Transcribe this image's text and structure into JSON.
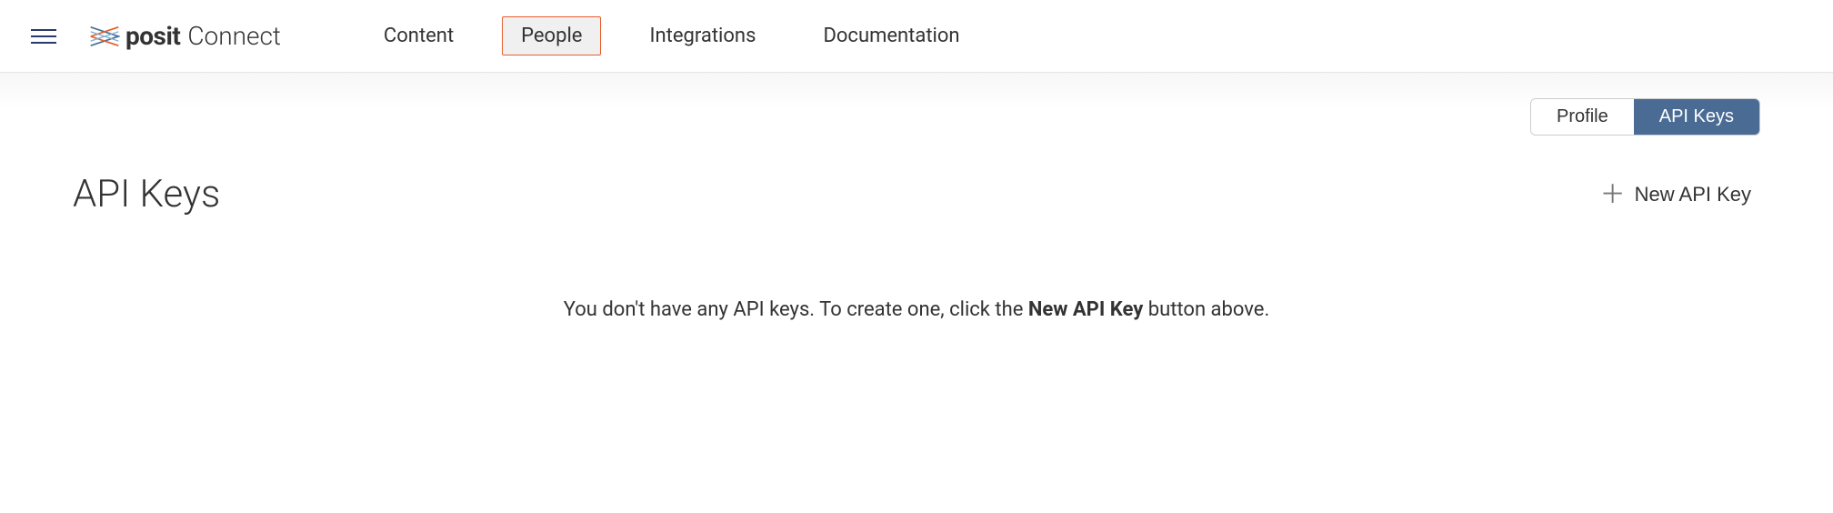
{
  "brand": {
    "name_bold": "posit",
    "name_light": "Connect"
  },
  "nav": {
    "content": "Content",
    "people": "People",
    "integrations": "Integrations",
    "documentation": "Documentation"
  },
  "tabs": {
    "profile": "Profile",
    "api_keys": "API Keys"
  },
  "page": {
    "title": "API Keys",
    "new_key_label": "New API Key"
  },
  "empty_state": {
    "prefix": "You don't have any API keys. To create one, click the ",
    "bold": "New API Key",
    "suffix": " button above."
  }
}
